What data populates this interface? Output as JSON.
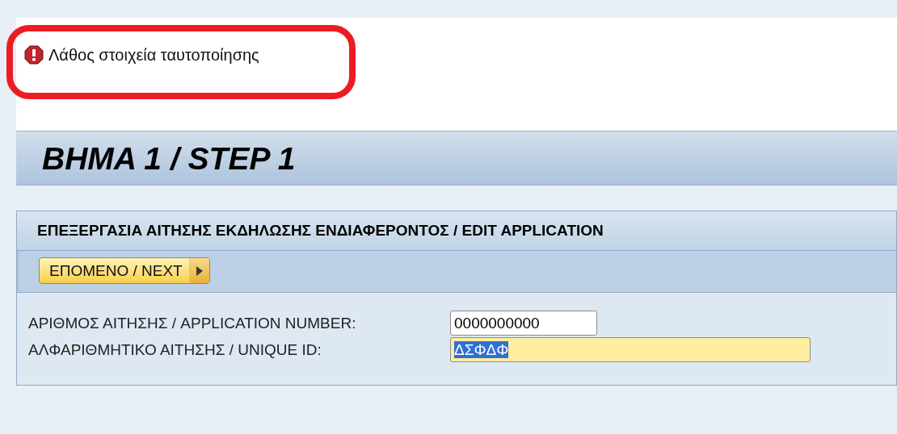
{
  "message": {
    "kind": "error",
    "text": "Λάθος στοιχεία ταυτοποίησης",
    "highlighted": true
  },
  "step_title": "BHMA 1 / STEP 1",
  "panel": {
    "title": "ΕΠΕΞΕΡΓΑΣΙΑ ΑΙΤΗΣΗΣ ΕΚΔΗΛΩΣΗΣ ΕΝΔΙΑΦΕΡΟΝΤΟΣ / EDIT APPLICATION",
    "buttons": [
      {
        "label": "ΕΠΟΜΕΝΟ / NEXT"
      }
    ],
    "fields": [
      {
        "label": "ΑΡΙΘΜΟΣ ΑΙΤΗΣΗΣ / APPLICATION NUMBER:",
        "value": "0000000000",
        "focused": false,
        "text_selected": false
      },
      {
        "label": "ΑΛΦΑΡΙΘΜΗΤΙΚΟ ΑΙΤΗΣΗΣ / UNIQUE ID:",
        "value": "ΔΣΦΔΦ",
        "focused": true,
        "text_selected": true
      }
    ]
  }
}
